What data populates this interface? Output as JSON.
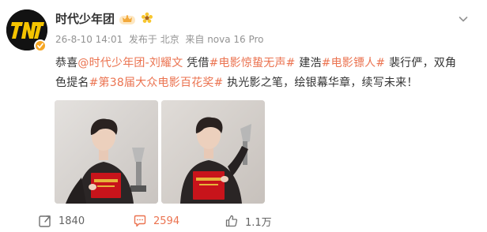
{
  "header": {
    "username": "时代少年团",
    "timestamp": "26-8-10 14:01",
    "published_from": "发布于 北京",
    "source": "来自 nova 16 Pro"
  },
  "icons": {
    "avatar": "tnt-logo-avatar",
    "verified": "verified-badge-icon",
    "crown": "crown-badge-icon",
    "flower": "sunflower-badge-icon",
    "more": "chevron-down-icon",
    "repost": "repost-icon",
    "comment": "comment-icon",
    "like": "like-icon"
  },
  "post": {
    "line1": {
      "t1": "恭喜",
      "mention": "@时代少年团-刘耀文",
      "t2": " 凭借",
      "tag1": "#电影惊蛰无声#",
      "t3": " 建浩",
      "tag2": "#电影镖人#",
      "t4": " 裴行俨，双角"
    },
    "line2": {
      "t1": "色提名",
      "tag3": "#第38届大众电影百花奖#",
      "t2": " 执光影之笔，绘银幕华章，续写未来！"
    }
  },
  "images": [
    {
      "alt": "photo-1"
    },
    {
      "alt": "photo-2"
    }
  ],
  "actions": {
    "repost_count": "1840",
    "comment_count": "2594",
    "like_count": "1.1万"
  },
  "colors": {
    "link": "#eb7350",
    "text": "#333333",
    "meta": "#939393",
    "verified": "#f6a623"
  }
}
